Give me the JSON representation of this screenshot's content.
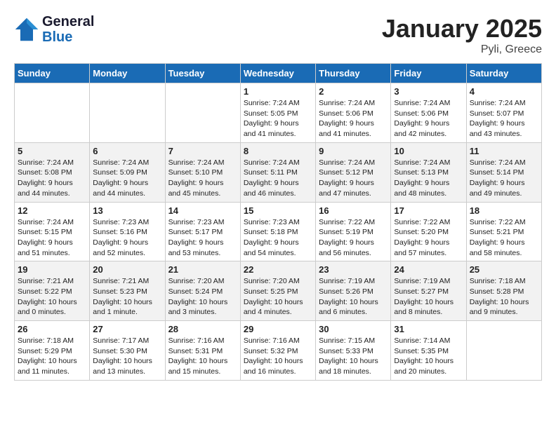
{
  "header": {
    "logo_line1": "General",
    "logo_line2": "Blue",
    "month_year": "January 2025",
    "location": "Pyli, Greece"
  },
  "days_of_week": [
    "Sunday",
    "Monday",
    "Tuesday",
    "Wednesday",
    "Thursday",
    "Friday",
    "Saturday"
  ],
  "weeks": [
    [
      {
        "day": "",
        "content": ""
      },
      {
        "day": "",
        "content": ""
      },
      {
        "day": "",
        "content": ""
      },
      {
        "day": "1",
        "content": "Sunrise: 7:24 AM\nSunset: 5:05 PM\nDaylight: 9 hours\nand 41 minutes."
      },
      {
        "day": "2",
        "content": "Sunrise: 7:24 AM\nSunset: 5:06 PM\nDaylight: 9 hours\nand 41 minutes."
      },
      {
        "day": "3",
        "content": "Sunrise: 7:24 AM\nSunset: 5:06 PM\nDaylight: 9 hours\nand 42 minutes."
      },
      {
        "day": "4",
        "content": "Sunrise: 7:24 AM\nSunset: 5:07 PM\nDaylight: 9 hours\nand 43 minutes."
      }
    ],
    [
      {
        "day": "5",
        "content": "Sunrise: 7:24 AM\nSunset: 5:08 PM\nDaylight: 9 hours\nand 44 minutes."
      },
      {
        "day": "6",
        "content": "Sunrise: 7:24 AM\nSunset: 5:09 PM\nDaylight: 9 hours\nand 44 minutes."
      },
      {
        "day": "7",
        "content": "Sunrise: 7:24 AM\nSunset: 5:10 PM\nDaylight: 9 hours\nand 45 minutes."
      },
      {
        "day": "8",
        "content": "Sunrise: 7:24 AM\nSunset: 5:11 PM\nDaylight: 9 hours\nand 46 minutes."
      },
      {
        "day": "9",
        "content": "Sunrise: 7:24 AM\nSunset: 5:12 PM\nDaylight: 9 hours\nand 47 minutes."
      },
      {
        "day": "10",
        "content": "Sunrise: 7:24 AM\nSunset: 5:13 PM\nDaylight: 9 hours\nand 48 minutes."
      },
      {
        "day": "11",
        "content": "Sunrise: 7:24 AM\nSunset: 5:14 PM\nDaylight: 9 hours\nand 49 minutes."
      }
    ],
    [
      {
        "day": "12",
        "content": "Sunrise: 7:24 AM\nSunset: 5:15 PM\nDaylight: 9 hours\nand 51 minutes."
      },
      {
        "day": "13",
        "content": "Sunrise: 7:23 AM\nSunset: 5:16 PM\nDaylight: 9 hours\nand 52 minutes."
      },
      {
        "day": "14",
        "content": "Sunrise: 7:23 AM\nSunset: 5:17 PM\nDaylight: 9 hours\nand 53 minutes."
      },
      {
        "day": "15",
        "content": "Sunrise: 7:23 AM\nSunset: 5:18 PM\nDaylight: 9 hours\nand 54 minutes."
      },
      {
        "day": "16",
        "content": "Sunrise: 7:22 AM\nSunset: 5:19 PM\nDaylight: 9 hours\nand 56 minutes."
      },
      {
        "day": "17",
        "content": "Sunrise: 7:22 AM\nSunset: 5:20 PM\nDaylight: 9 hours\nand 57 minutes."
      },
      {
        "day": "18",
        "content": "Sunrise: 7:22 AM\nSunset: 5:21 PM\nDaylight: 9 hours\nand 58 minutes."
      }
    ],
    [
      {
        "day": "19",
        "content": "Sunrise: 7:21 AM\nSunset: 5:22 PM\nDaylight: 10 hours\nand 0 minutes."
      },
      {
        "day": "20",
        "content": "Sunrise: 7:21 AM\nSunset: 5:23 PM\nDaylight: 10 hours\nand 1 minute."
      },
      {
        "day": "21",
        "content": "Sunrise: 7:20 AM\nSunset: 5:24 PM\nDaylight: 10 hours\nand 3 minutes."
      },
      {
        "day": "22",
        "content": "Sunrise: 7:20 AM\nSunset: 5:25 PM\nDaylight: 10 hours\nand 4 minutes."
      },
      {
        "day": "23",
        "content": "Sunrise: 7:19 AM\nSunset: 5:26 PM\nDaylight: 10 hours\nand 6 minutes."
      },
      {
        "day": "24",
        "content": "Sunrise: 7:19 AM\nSunset: 5:27 PM\nDaylight: 10 hours\nand 8 minutes."
      },
      {
        "day": "25",
        "content": "Sunrise: 7:18 AM\nSunset: 5:28 PM\nDaylight: 10 hours\nand 9 minutes."
      }
    ],
    [
      {
        "day": "26",
        "content": "Sunrise: 7:18 AM\nSunset: 5:29 PM\nDaylight: 10 hours\nand 11 minutes."
      },
      {
        "day": "27",
        "content": "Sunrise: 7:17 AM\nSunset: 5:30 PM\nDaylight: 10 hours\nand 13 minutes."
      },
      {
        "day": "28",
        "content": "Sunrise: 7:16 AM\nSunset: 5:31 PM\nDaylight: 10 hours\nand 15 minutes."
      },
      {
        "day": "29",
        "content": "Sunrise: 7:16 AM\nSunset: 5:32 PM\nDaylight: 10 hours\nand 16 minutes."
      },
      {
        "day": "30",
        "content": "Sunrise: 7:15 AM\nSunset: 5:33 PM\nDaylight: 10 hours\nand 18 minutes."
      },
      {
        "day": "31",
        "content": "Sunrise: 7:14 AM\nSunset: 5:35 PM\nDaylight: 10 hours\nand 20 minutes."
      },
      {
        "day": "",
        "content": ""
      }
    ]
  ]
}
